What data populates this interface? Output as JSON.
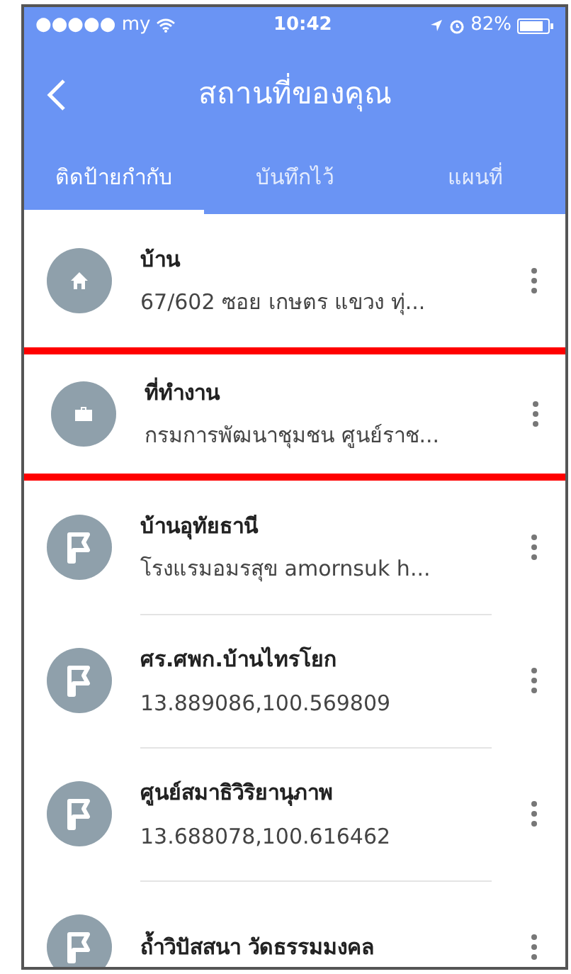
{
  "status_bar": {
    "carrier": "●●●●● my",
    "time": "10:42",
    "battery": "82%"
  },
  "header": {
    "title": "สถานที่ของคุณ"
  },
  "tabs": [
    {
      "label": "ติดป้ายกำกับ",
      "selected": true
    },
    {
      "label": "บันทึกไว้",
      "selected": false
    },
    {
      "label": "แผนที่",
      "selected": false
    }
  ],
  "places": [
    {
      "kind": "home",
      "name": "บ้าน",
      "address": "67/602 ซอย เกษตร แขวง ทุ่...",
      "highlighted": false
    },
    {
      "kind": "work",
      "name": "ที่ทำงาน",
      "address": "กรมการพัฒนาชุมชน ศูนย์ราช...",
      "highlighted": true
    },
    {
      "kind": "flag",
      "name": "บ้านอุทัยธานี",
      "address": "โรงแรมอมรสุข amornsuk h...",
      "highlighted": false
    },
    {
      "kind": "flag",
      "name": "ศร.ศพก.บ้านไทรโยก",
      "address": "13.889086,100.569809",
      "highlighted": false
    },
    {
      "kind": "flag",
      "name": "ศูนย์สมาธิวิริยานุภาพ",
      "address": "13.688078,100.616462",
      "highlighted": false
    },
    {
      "kind": "flag",
      "name": "ถ้ำวิปัสสนา วัดธรรมมงคล",
      "highlighted": false
    }
  ]
}
